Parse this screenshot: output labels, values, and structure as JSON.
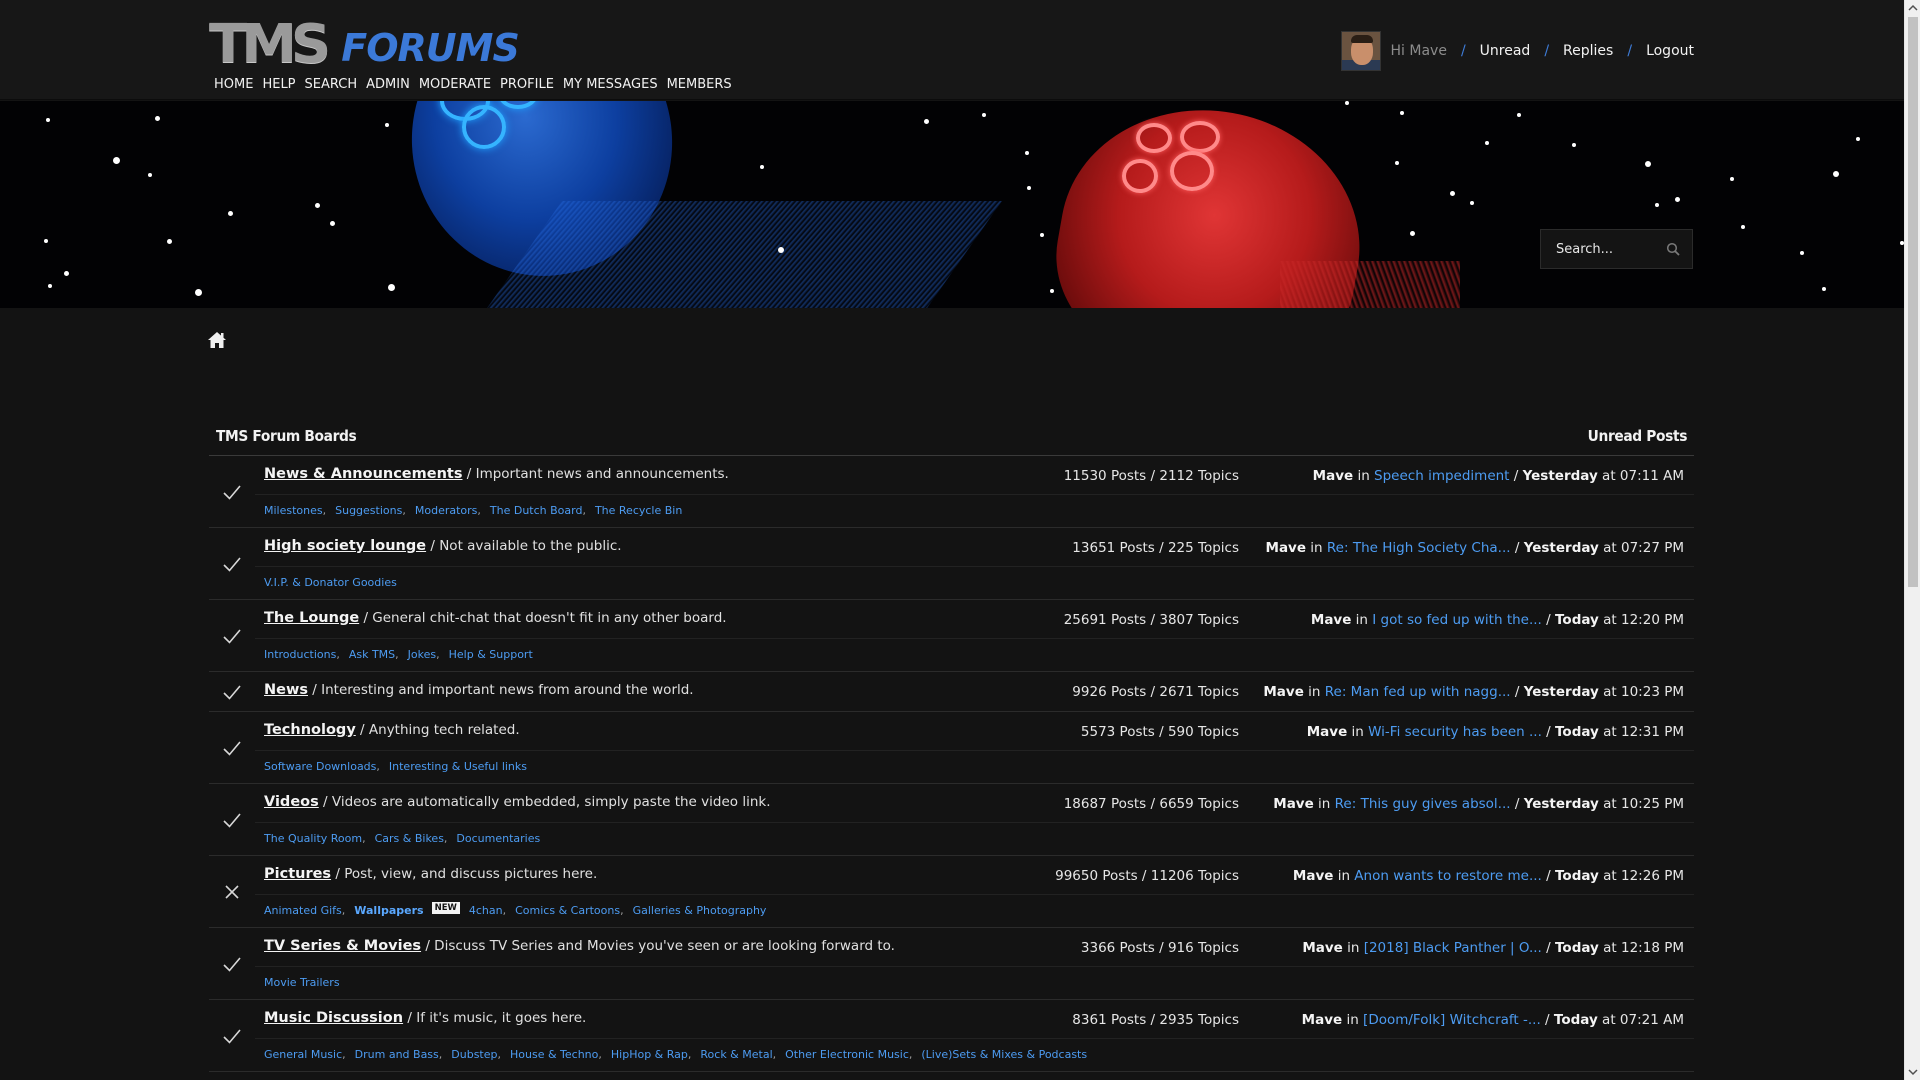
{
  "logo": {
    "tms": "TMS",
    "forums": "FORUMS"
  },
  "nav": [
    "HOME",
    "HELP",
    "SEARCH",
    "ADMIN",
    "MODERATE",
    "PROFILE",
    "MY MESSAGES",
    "MEMBERS"
  ],
  "user": {
    "greeting": "Hi Mave",
    "links": [
      "Unread",
      "Replies",
      "Logout"
    ]
  },
  "search": {
    "placeholder": "Search..."
  },
  "boards_title": "TMS Forum Boards",
  "unread_title": "Unread Posts",
  "colors": {
    "link": "#4d9cf2",
    "accent": "#3b79d8",
    "bg": "#131313"
  },
  "boards": [
    {
      "name": "News & Announcements",
      "desc": " / Important news and announcements.",
      "stats": "11530 Posts / 2112 Topics",
      "status": "check-icon",
      "last": {
        "user": "Mave",
        "in": " in ",
        "topic": "Speech impediment",
        "sep": " / ",
        "day": "Yesterday",
        "time": " at 07:11 AM"
      },
      "subs": [
        "Milestones",
        "Suggestions",
        "Moderators",
        "The Dutch Board",
        "The Recycle Bin"
      ]
    },
    {
      "name": "High society lounge",
      "desc": " / Not available to the public.",
      "stats": "13651 Posts / 225 Topics",
      "status": "check-icon",
      "last": {
        "user": "Mave",
        "in": " in ",
        "topic": "Re: The High Society Cha...",
        "sep": " / ",
        "day": "Yesterday",
        "time": " at 07:27 PM"
      },
      "subs": [
        "V.I.P. & Donator Goodies"
      ]
    },
    {
      "name": "The Lounge",
      "desc": " / General chit-chat that doesn't fit in any other board.",
      "stats": "25691 Posts / 3807 Topics",
      "status": "check-icon",
      "last": {
        "user": "Mave",
        "in": " in ",
        "topic": "I got so fed up with the...",
        "sep": " / ",
        "day": "Today",
        "time": " at 12:20 PM"
      },
      "subs": [
        "Introductions",
        "Ask TMS",
        "Jokes",
        "Help & Support"
      ]
    },
    {
      "name": "News",
      "desc": " / Interesting and important news from around the world.",
      "stats": "9926 Posts / 2671 Topics",
      "status": "check-icon",
      "last": {
        "user": "Mave",
        "in": " in ",
        "topic": "Re: Man fed up with nagg...",
        "sep": " / ",
        "day": "Yesterday",
        "time": " at 10:23 PM"
      },
      "subs": []
    },
    {
      "name": "Technology",
      "desc": " / Anything tech related.",
      "stats": "5573 Posts / 590 Topics",
      "status": "check-icon",
      "last": {
        "user": "Mave",
        "in": " in ",
        "topic": "Wi-Fi security has been ...",
        "sep": " / ",
        "day": "Today",
        "time": " at 12:31 PM"
      },
      "subs": [
        "Software Downloads",
        "Interesting & Useful links"
      ]
    },
    {
      "name": "Videos",
      "desc": " / Videos are automatically embedded, simply paste the video link.",
      "stats": "18687 Posts / 6659 Topics",
      "status": "check-icon",
      "last": {
        "user": "Mave",
        "in": " in ",
        "topic": "Re: This guy gives absol...",
        "sep": " / ",
        "day": "Yesterday",
        "time": " at 10:25 PM"
      },
      "subs": [
        "The Quality Room",
        "Cars & Bikes",
        "Documentaries"
      ]
    },
    {
      "name": "Pictures",
      "desc": " / Post, view, and discuss pictures here.",
      "stats": "99650 Posts / 11206 Topics",
      "status": "x-icon",
      "last": {
        "user": "Mave",
        "in": " in ",
        "topic": "Anon wants to restore me...",
        "sep": " / ",
        "day": "Today",
        "time": " at 12:26 PM"
      },
      "subs": [
        "Animated Gifs",
        "Wallpapers",
        "4chan",
        "Comics & Cartoons",
        "Galleries & Photography"
      ],
      "new_after": "Wallpapers",
      "new_label": "NEW"
    },
    {
      "name": "TV Series & Movies",
      "desc": " / Discuss TV Series and Movies you've seen or are looking forward to.",
      "stats": "3366 Posts / 916 Topics",
      "status": "check-icon",
      "last": {
        "user": "Mave",
        "in": " in ",
        "topic": "[2018] Black Panther | O...",
        "sep": " / ",
        "day": "Today",
        "time": " at 12:18 PM"
      },
      "subs": [
        "Movie Trailers"
      ]
    },
    {
      "name": "Music Discussion",
      "desc": " / If it's music, it goes here.",
      "stats": "8361 Posts / 2935 Topics",
      "status": "check-icon",
      "last": {
        "user": "Mave",
        "in": " in ",
        "topic": "[Doom/Folk] Witchcraft -...",
        "sep": " / ",
        "day": "Today",
        "time": " at 07:21 AM"
      },
      "subs": [
        "General Music",
        "Drum and Bass",
        "Dubstep",
        "House & Techno",
        "HipHop & Rap",
        "Rock & Metal",
        "Other Electronic Music",
        "(Live)Sets & Mixes & Podcasts"
      ]
    }
  ]
}
